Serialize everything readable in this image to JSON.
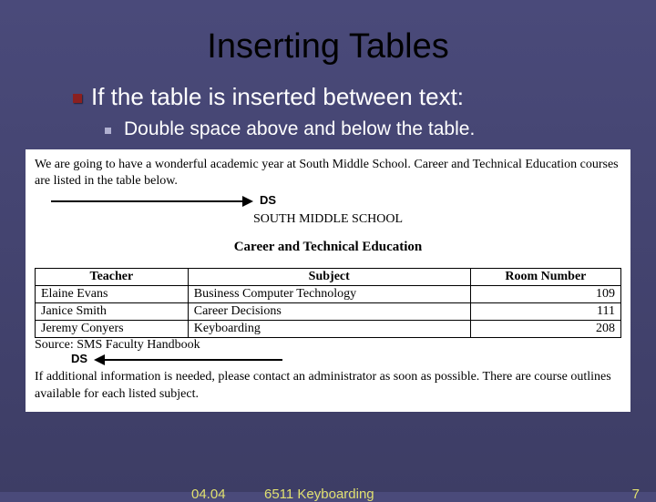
{
  "title": "Inserting Tables",
  "bullet_main": "If the table is inserted between text:",
  "bullet_sub": "Double space above and below the table.",
  "doc": {
    "intro": "We are going to have a wonderful academic year at South Middle School. Career and Technical Education courses are listed in the table below.",
    "ds_top": "DS",
    "school": "SOUTH MIDDLE SCHOOL",
    "cte": "Career and Technical Education",
    "headers": {
      "teacher": "Teacher",
      "subject": "Subject",
      "room": "Room Number"
    },
    "rows": [
      {
        "teacher": "Elaine Evans",
        "subject": "Business Computer Technology",
        "room": "109"
      },
      {
        "teacher": "Janice Smith",
        "subject": "Career Decisions",
        "room": "111"
      },
      {
        "teacher": "Jeremy Conyers",
        "subject": "Keyboarding",
        "room": "208"
      }
    ],
    "source": "Source: SMS Faculty Handbook",
    "ds_bottom": "DS",
    "outro": "If additional information is needed, please contact an administrator as soon as possible. There are course outlines available for each listed subject."
  },
  "footer": {
    "code": "04.04",
    "course": "6511 Keyboarding",
    "page": "7"
  }
}
